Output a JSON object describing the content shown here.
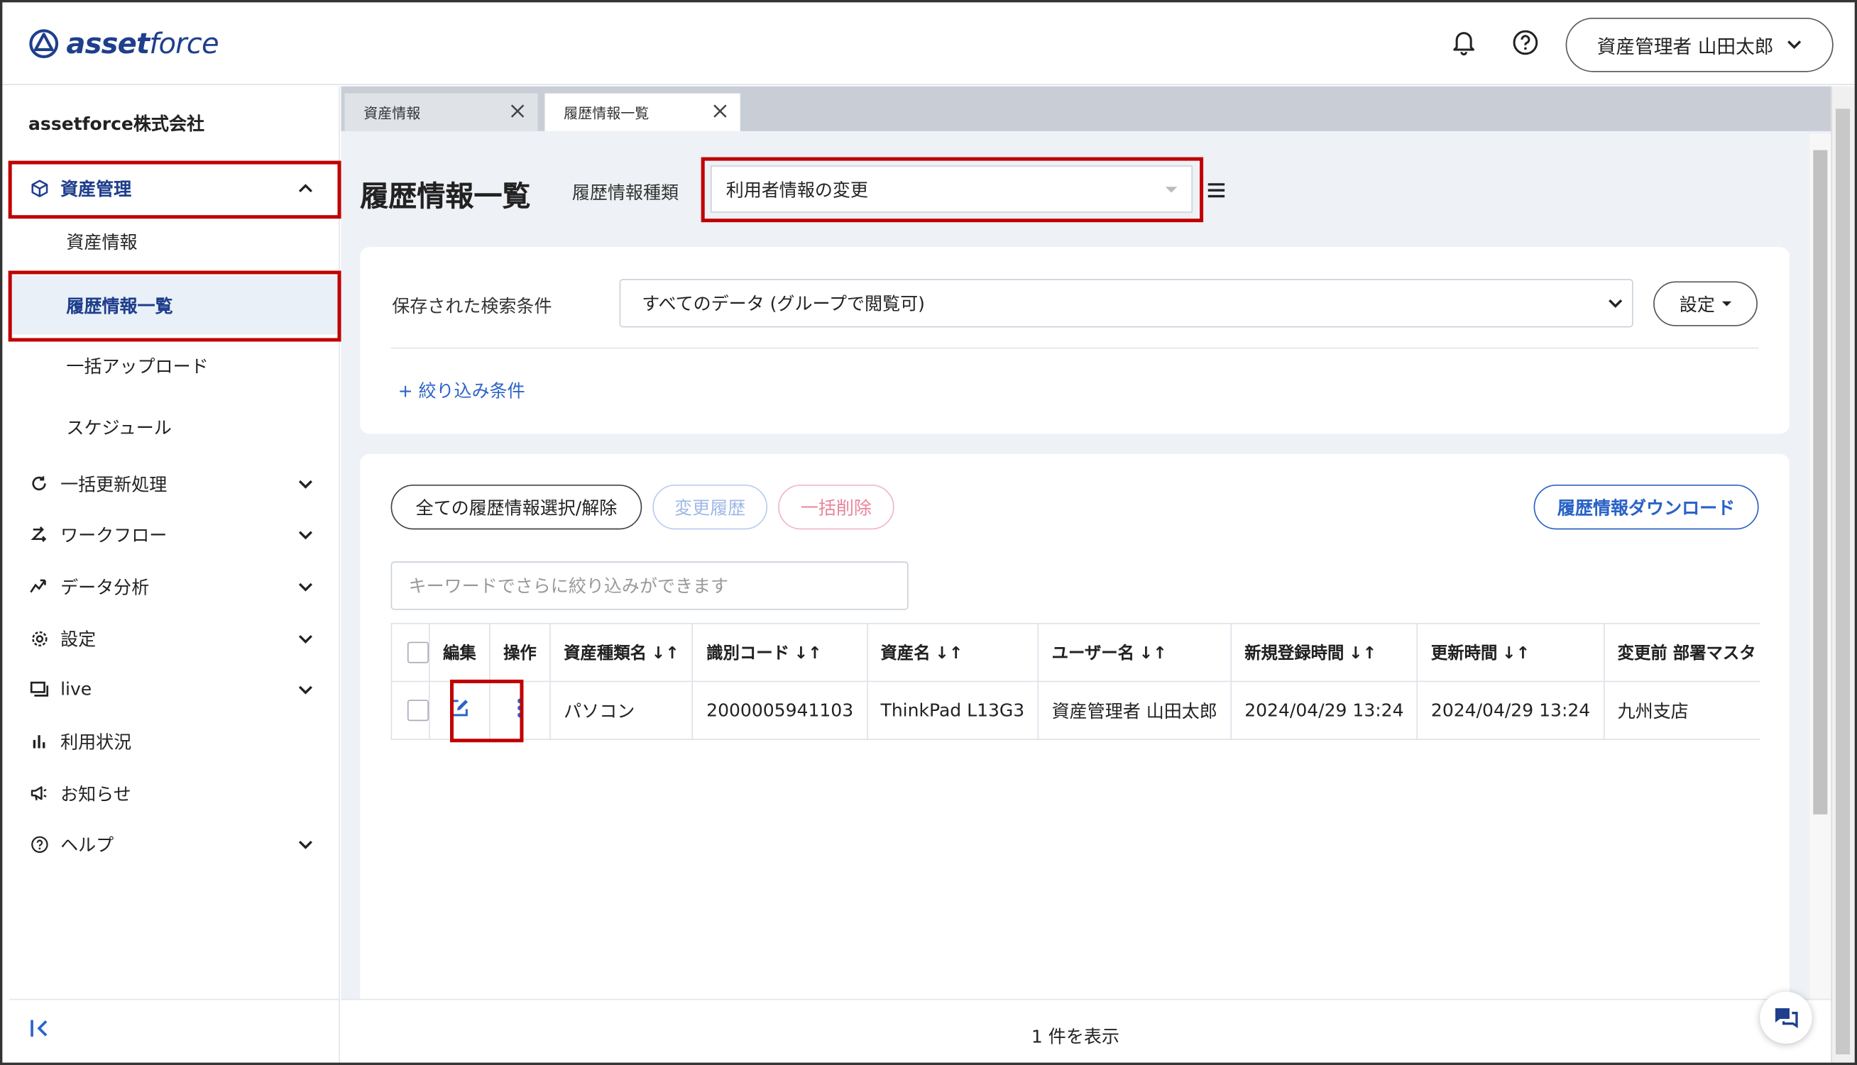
{
  "header": {
    "logo_text_bold": "asset",
    "logo_text_light": "force",
    "user_label": "資産管理者 山田太郎",
    "bell_icon": "bell-icon",
    "help_icon": "help-icon"
  },
  "sidebar": {
    "company": "assetforce株式会社",
    "asset_mgmt": "資産管理",
    "sub_items": [
      "資産情報",
      "履歴情報一覧",
      "一括アップロード",
      "スケジュール"
    ],
    "items": [
      {
        "label": "一括更新処理",
        "icon": "refresh-icon"
      },
      {
        "label": "ワークフロー",
        "icon": "workflow-icon"
      },
      {
        "label": "データ分析",
        "icon": "analytics-icon"
      },
      {
        "label": "設定",
        "icon": "gear-icon"
      },
      {
        "label": "live",
        "icon": "live-icon"
      },
      {
        "label": "利用状況",
        "icon": "usage-chart-icon"
      },
      {
        "label": "お知らせ",
        "icon": "megaphone-icon"
      },
      {
        "label": "ヘルプ",
        "icon": "help-icon"
      }
    ]
  },
  "tabs": [
    "資産情報",
    "履歴情報一覧"
  ],
  "main": {
    "page_title": "履歴情報一覧",
    "type_label": "履歴情報種類",
    "type_value": "利用者情報の変更",
    "saved_search_label": "保存された検索条件",
    "saved_search_value": "すべてのデータ (グループで閲覧可)",
    "settings_button": "設定",
    "filter_link": "+ 絞り込み条件",
    "select_all_button": "全ての履歴情報選択/解除",
    "change_history_button": "変更履歴",
    "bulk_delete_button": "一括削除",
    "download_button": "履歴情報ダウンロード",
    "keyword_placeholder": "キーワードでさらに絞り込みができます",
    "footer_count": "1 件を表示"
  },
  "table": {
    "headers": [
      "編集",
      "操作",
      "資産種類名",
      "識別コード",
      "資産名",
      "ユーザー名",
      "新規登録時間",
      "更新時間",
      "変更前 部署マスタ"
    ],
    "rows": [
      [
        "パソコン",
        "2000005941103",
        "ThinkPad L13G3",
        "資産管理者 山田太郎",
        "2024/04/29 13:24",
        "2024/04/29 13:24",
        "九州支店"
      ]
    ]
  },
  "colors": {
    "brand": "#1f3f8c",
    "highlight_red": "#c00000",
    "link_blue": "#2b63c7",
    "danger_pink": "#e8849a"
  }
}
